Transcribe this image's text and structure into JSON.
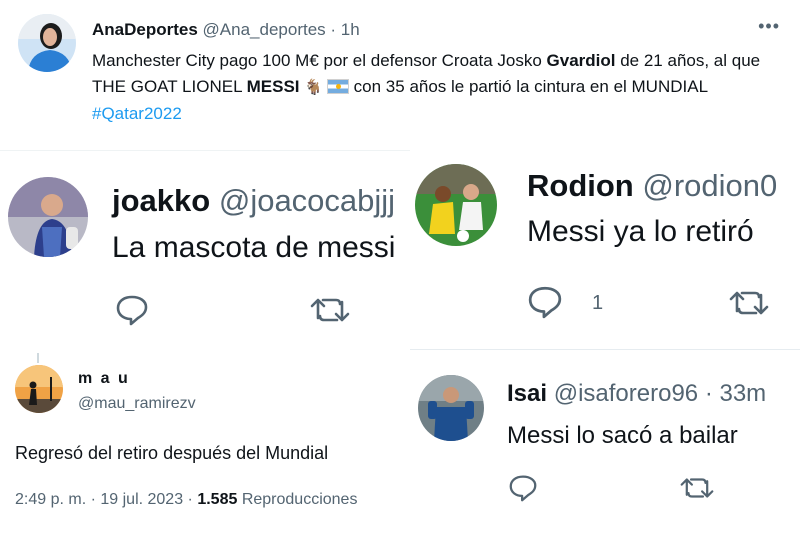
{
  "main_tweet": {
    "author_name": "AnaDeportes",
    "author_handle": "@Ana_deportes",
    "time": "· 1h",
    "more_icon": "more-dots-icon",
    "text_part1": "Manchester City pago 100 M€ por el defensor Croata Josko ",
    "bold1": "Gvardiol",
    "text_part2": " de 21 años, al que THE GOAT LIONEL ",
    "bold2": "MESSI",
    "emoji_goat": "🐐",
    "text_part3": " con 35 años le partió la cintura en el MUNDIAL ",
    "hashtag": "#Qatar2022"
  },
  "reply_joakko": {
    "author_name": "joakko",
    "author_handle": "@joacocabjjj",
    "text": "La mascota de messi",
    "icons": [
      "reply-icon",
      "retweet-icon"
    ]
  },
  "reply_rodion": {
    "author_name": "Rodion",
    "author_handle": "@rodion0",
    "text": "Messi ya lo retiró",
    "reply_count": "1",
    "icons": [
      "reply-icon",
      "retweet-icon"
    ]
  },
  "tweet_mau": {
    "author_name": "m a u",
    "author_handle": "@mau_ramirezv",
    "text": "Regresó del retiro después del Mundial",
    "time": "2:49 p. m. · 19 jul. 2023 · ",
    "views_count": "1.585",
    "views_label": " Reproducciones"
  },
  "reply_isai": {
    "author_name": "Isai",
    "author_handle": "@isaforero96",
    "time": "· 33m",
    "text": "Messi lo sacó a bailar",
    "icons": [
      "reply-icon",
      "retweet-icon"
    ]
  },
  "colors": {
    "link": "#1d9bf0",
    "secondary_text": "#536471",
    "primary_text": "#0f1419"
  }
}
